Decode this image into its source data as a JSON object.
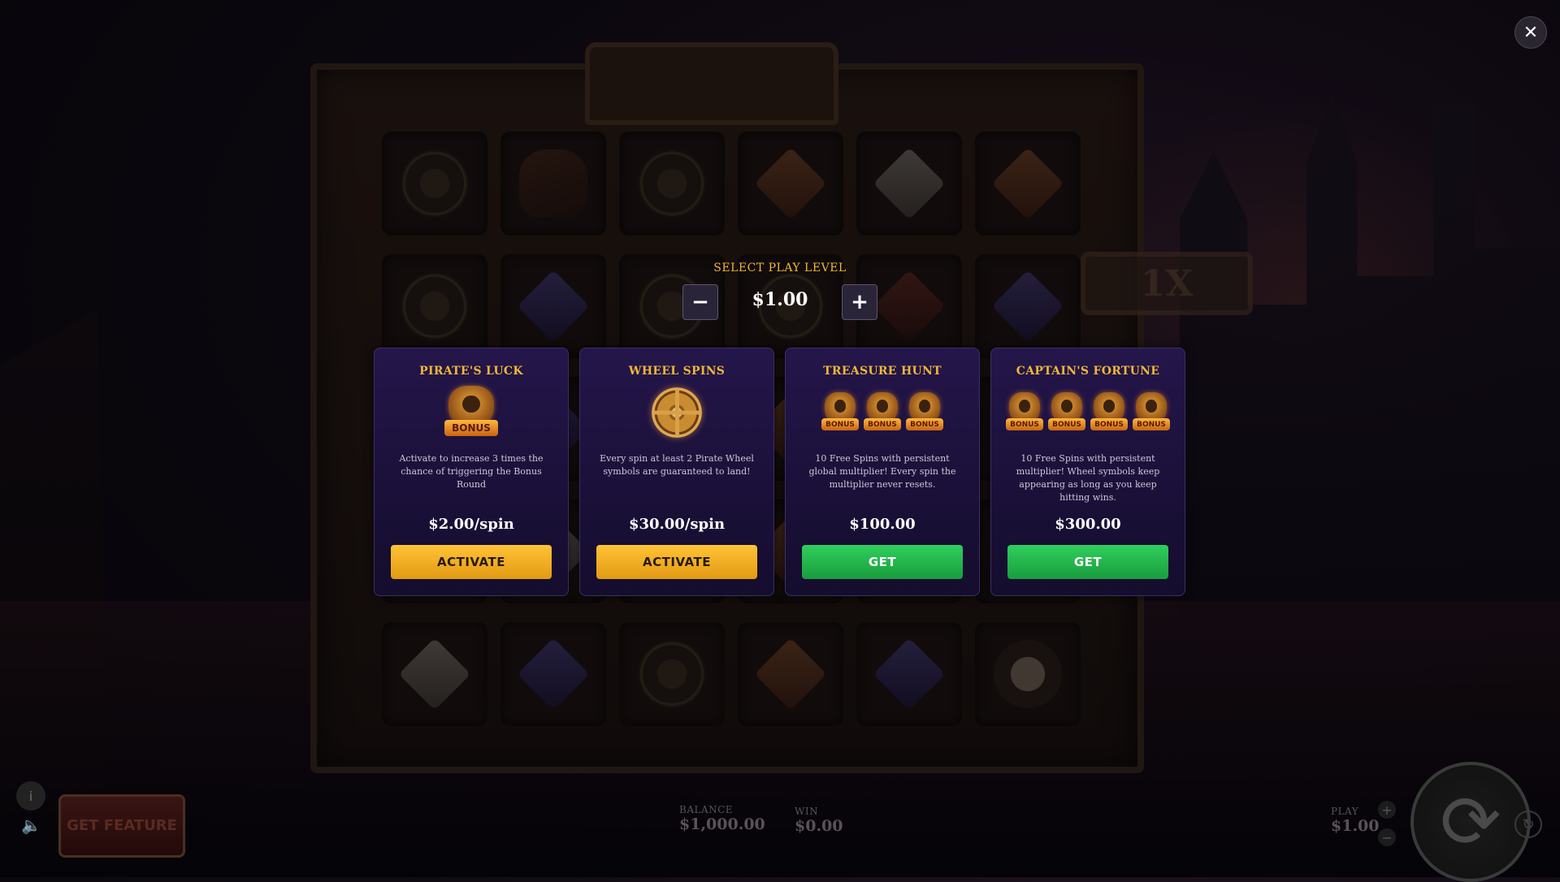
{
  "game": {
    "multiplier_sign": "1X"
  },
  "reels": [
    [
      "compass",
      "bottle",
      "compass",
      "gem-o",
      "gem-w",
      "gem-o"
    ],
    [
      "compass",
      "gem-b",
      "compass",
      "coins",
      "gem-r",
      "gem-b"
    ],
    [
      "compass",
      "gem-b",
      "compass",
      "gem-o",
      "gem-b",
      "gem-r"
    ],
    [
      "compass",
      "gem-w",
      "compass",
      "gem-o",
      "gem-w",
      "gem-o"
    ],
    [
      "gem-w",
      "gem-b",
      "compass",
      "gem-o",
      "gem-b",
      "skull"
    ]
  ],
  "play_level": {
    "label": "SELECT PLAY LEVEL",
    "value": "$1.00",
    "minus": "−",
    "plus": "+"
  },
  "features": [
    {
      "title": "PIRATE'S LUCK",
      "icon": "bonus-badge-icon",
      "icon_count": 1,
      "badge_text": "BONUS",
      "description": "Activate to increase 3 times the chance of triggering the Bonus Round",
      "price": "$2.00/spin",
      "button": "ACTIVATE",
      "button_type": "activate"
    },
    {
      "title": "WHEEL SPINS",
      "icon": "pirate-wheel-icon",
      "icon_count": 1,
      "badge_text": "",
      "description": "Every spin at least 2 Pirate Wheel symbols are guaranteed to land!",
      "price": "$30.00/spin",
      "button": "ACTIVATE",
      "button_type": "activate"
    },
    {
      "title": "TREASURE HUNT",
      "icon": "bonus-badge-icon",
      "icon_count": 3,
      "badge_text": "BONUS",
      "description": "10 Free Spins with persistent global multiplier! Every spin the multiplier never resets.",
      "price": "$100.00",
      "button": "GET",
      "button_type": "get"
    },
    {
      "title": "CAPTAIN'S FORTUNE",
      "icon": "bonus-badge-icon",
      "icon_count": 4,
      "badge_text": "BONUS",
      "description": "10 Free Spins with persistent multiplier! Wheel symbols keep appearing as long as you keep hitting wins.",
      "price": "$300.00",
      "button": "GET",
      "button_type": "get"
    }
  ],
  "close": "✕",
  "hud": {
    "info": "i",
    "sound": "🔈",
    "get_feature": "GET FEATURE",
    "balance_label": "BALANCE",
    "balance_value": "$1,000.00",
    "win_label": "WIN",
    "win_value": "$0.00",
    "play_label": "PLAY",
    "play_value": "$1.00",
    "spin": "⟳",
    "plus": "+",
    "minus": "−",
    "autoplay": "↻"
  },
  "colors": {
    "accent_gold": "#f0b63a",
    "activate_yellow": "#ffc436",
    "get_green": "#2fcf5c",
    "card_bg": "#1a1038"
  }
}
